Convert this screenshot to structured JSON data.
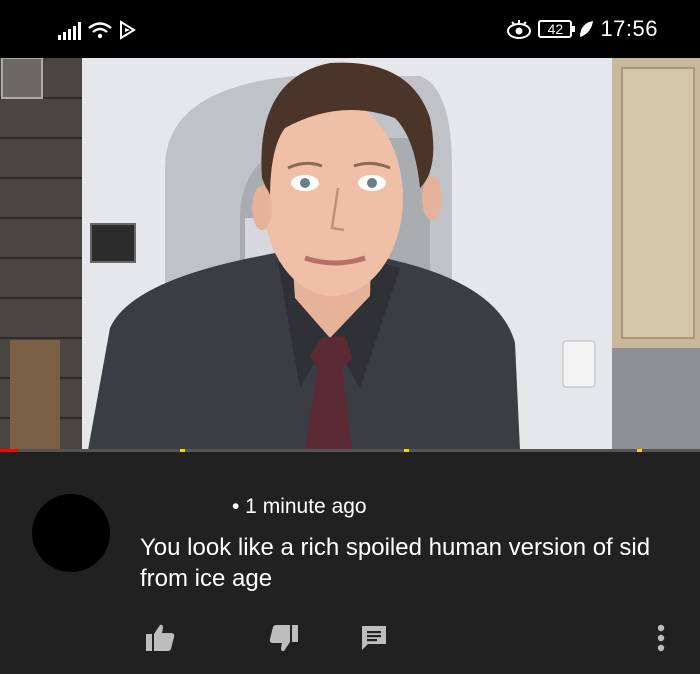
{
  "status_bar": {
    "battery_level": "42",
    "time": "17:56",
    "icons": [
      "signal-icon",
      "wifi-icon",
      "cast-icon",
      "eye-icon",
      "battery-icon",
      "leaf-icon"
    ]
  },
  "video": {
    "progress_fraction": 0.025,
    "colors": {
      "progress": "#ff0000",
      "ad_marker": "#f7d600"
    }
  },
  "comment": {
    "meta": "• 1 minute ago",
    "text": "You look like a rich spoiled human version of sid from ice age",
    "actions": [
      "like-icon",
      "dislike-icon",
      "reply-icon",
      "more-icon"
    ]
  }
}
